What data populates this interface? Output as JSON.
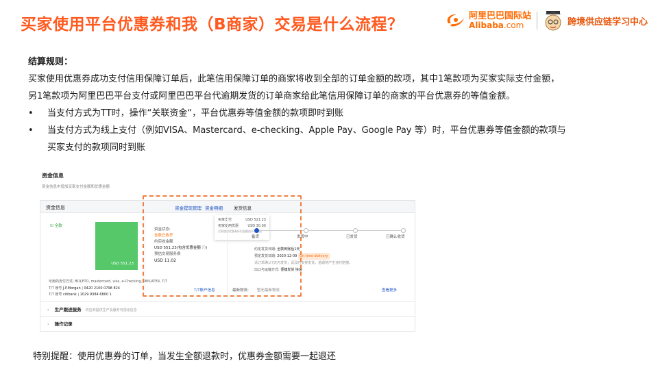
{
  "header": {
    "title": "买家使用平台优惠券和我（B商家）交易是什么流程？",
    "logo_cn": "阿里巴巴国际站",
    "logo_en": "Alibaba",
    "logo_domain": ".com",
    "center_name": "跨境供应链学习中心"
  },
  "rules": {
    "heading": "结算规则：",
    "para1": "买家使用优惠券成功支付信用保障订单后，此笔信用保障订单的商家将收到全部的订单金额的款项，其中1笔款项为买家实际支付金额，",
    "para2": "另1笔款项为阿里巴巴平台支付或阿里巴巴平台代逾期发货的订单商家给此笔信用保障订单的商家的平台优惠券的等值金额。",
    "bullet1": "当支付方式为TT时，操作“关联资金“，平台优惠券等值金额的款项即时到账",
    "bullet2_line1": "当支付方式为线上支付（例如VISA、Mastercard、e-checking、Apple  Pay、Google  Pay  等）时，平台优惠券等值金额的款项与",
    "bullet2_line2": "买家支付的款项同时到账"
  },
  "screenshot": {
    "section_title": "资金信息",
    "section_sub": "资金信息中增加买家支付金额和优惠金额",
    "panel_label": "资金信息",
    "link_fund_mgmt": "资金提现管理",
    "link_fund_detail": "资金明细",
    "link_shipping": "发货信息",
    "all_tag": "全款",
    "green_amount": "USD 551.23",
    "finance_status_label": "资金状态:",
    "finance_status_value": "全款已收齐",
    "finance_received_label": "约实收金额",
    "finance_received_value": "USD 551.23(包含优惠金额 ⓘ)",
    "finance_fee_label": "预估交易服务费",
    "finance_fee_value": "USD 11.02",
    "tooltip": {
      "row1_label": "买家支付",
      "row1_value": "USD 521.23",
      "row2_label": "买家使用优惠",
      "row2_value": "USD 30.00",
      "note": "买家使用优惠券折扣金额由平台承担"
    },
    "steps": [
      "备货",
      "发货中",
      "已发货",
      "已确认收货"
    ],
    "ship_line1_label": "约定发货日期:",
    "ship_line1_value": "全款到账后1天",
    "ship_line2_label": "预定发货日期:",
    "ship_line2_value": "2020-12-09",
    "ship_line2_tag": "On time delivery",
    "ship_line3": "请订单确认7天内发货，请及时安排发货，逾期将产生违约赔偿。",
    "ship_line4_label": "出口与运输方式:",
    "ship_line4_value": "便捷发货 快递",
    "pay_methods": "可用的支付方式: BOLETO, mastercard, visa, e-Checking, PAYLATER, T/T",
    "tt1_label": "T/T 账号",
    "tt1_bank": "J.P.Morgan",
    "tt1_number": "0420 2100 0798 824",
    "tt2_label": "T/T 账号",
    "tt2_bank": "citibank",
    "tt2_number": "1029 9384 6800 1",
    "tt_link": "T/T账户信息",
    "logistics_label": "最新物流:",
    "logistics_value": "暂无最新物流",
    "more_link": "查看更多",
    "fold1_title": "生产跟进服务",
    "fold1_desc": "供应商提供生产及服务可视化信息",
    "fold2_title": "操作记录"
  },
  "footer": {
    "reminder": "特别提醒：使用优惠券的订单，当发生全额退款时，优惠券金额需要一起退还"
  },
  "colors": {
    "title": "#ff5a1f",
    "brand": "#ff6a00",
    "link": "#1c55c4",
    "highlight_dash": "#f07e40",
    "progress_green": "#56c86a"
  }
}
